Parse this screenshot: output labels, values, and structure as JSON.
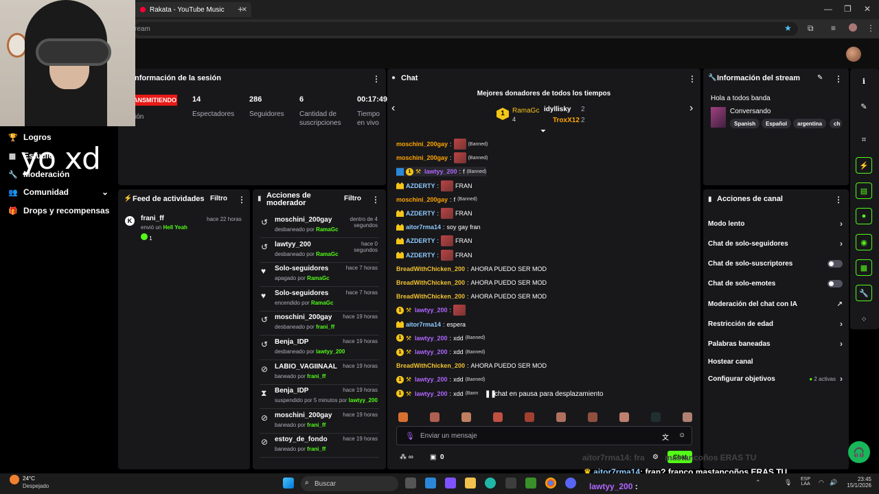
{
  "browser": {
    "tab_title": "Rakata - YouTube Music",
    "new_tab": "+",
    "address": "ream"
  },
  "overlay": {
    "webcam_text": "yo xd"
  },
  "nav": [
    {
      "label": "Logros",
      "icon": "trophy-icon"
    },
    {
      "label": "Estudio",
      "icon": "studio-icon"
    },
    {
      "label": "Moderación",
      "icon": "wrench-icon"
    },
    {
      "label": "Comunidad",
      "icon": "users-icon"
    },
    {
      "label": "Drops y recompensas",
      "icon": "gift-icon"
    }
  ],
  "session": {
    "title": "nformación de la sesión",
    "live": "ANSMITIENDO",
    "live_sub": "ión",
    "stats": [
      {
        "value": "14",
        "label": "Espectadores"
      },
      {
        "value": "286",
        "label": "Seguidores"
      },
      {
        "value": "6",
        "label": "Cantidad de suscripciones"
      },
      {
        "value": "00:17:49",
        "label": "Tiempo en vivo"
      }
    ]
  },
  "feed": {
    "title": "Feed de actividades",
    "filter": "Filtro",
    "item": {
      "user": "frani_ff",
      "action": "envió un",
      "gift": "Hell Yeah",
      "time": "hace 22 horas",
      "count": "1"
    }
  },
  "mod": {
    "title": "Acciones de moderador",
    "filter": "Filtro",
    "rows": [
      {
        "icon": "undo-icon",
        "title": "moschini_200gay",
        "sub": "desbaneado por",
        "by": "RamaGc",
        "time": "dentro de 4 segundos"
      },
      {
        "icon": "undo-icon",
        "title": "lawtyy_200",
        "sub": "desbaneado por",
        "by": "RamaGc",
        "time": "hace 0 segundos"
      },
      {
        "icon": "heart-icon",
        "title": "Solo-seguidores",
        "sub": "apagado por",
        "by": "RamaGc",
        "time": "hace 7 horas"
      },
      {
        "icon": "heart-icon",
        "title": "Solo-seguidores",
        "sub": "encendido por",
        "by": "RamaGc",
        "time": "hace 7 horas"
      },
      {
        "icon": "undo-icon",
        "title": "moschini_200gay",
        "sub": "desbaneado por",
        "by": "frani_ff",
        "time": "hace 19 horas"
      },
      {
        "icon": "undo-icon",
        "title": "Benja_IDP",
        "sub": "desbaneado por",
        "by": "lawtyy_200",
        "time": "hace 19 horas"
      },
      {
        "icon": "ban-icon",
        "title": "LABIO_VAGIINAAL",
        "sub": "baneado por",
        "by": "frani_ff",
        "time": "hace 19 horas"
      },
      {
        "icon": "hourglass-icon",
        "title": "Benja_IDP",
        "sub": "suspendido por 5 minutos por",
        "by": "lawtyy_200",
        "time": "hace 19 horas"
      },
      {
        "icon": "ban-icon",
        "title": "moschini_200gay",
        "sub": "baneado por",
        "by": "frani_ff",
        "time": "hace 19 horas"
      },
      {
        "icon": "ban-icon",
        "title": "estoy_de_fondo",
        "sub": "baneado por",
        "by": "frani_ff",
        "time": "hace 19 horas"
      }
    ]
  },
  "chat": {
    "title": "Chat",
    "donors_title": "Mejores donadores de todos los tiempos",
    "donors": [
      {
        "rank": "1",
        "name": "RamaGc",
        "count": "4"
      },
      {
        "name": "idyllisky",
        "count": "2"
      },
      {
        "name": "TroxX12",
        "count": "2"
      }
    ],
    "messages": [
      {
        "user": "moschini_200gay",
        "color": "or",
        "text": "",
        "emote": true,
        "banned": "(Banned)"
      },
      {
        "user": "moschini_200gay",
        "color": "or",
        "text": "",
        "emote": true,
        "banned": "(Banned)"
      },
      {
        "user": "lawtyy_200",
        "color": "pu",
        "text": "f",
        "banned": "(Banned)",
        "badges": "vc"
      },
      {
        "user": "AZDERTY",
        "color": "cy",
        "text": "FRAN",
        "emote": true,
        "badges": "s"
      },
      {
        "user": "moschini_200gay",
        "color": "or",
        "text": "f",
        "banned": "(Banned)"
      },
      {
        "user": "AZDERTY",
        "color": "cy",
        "text": "FRAN",
        "emote": true,
        "badges": "s"
      },
      {
        "user": "aitor7rma14",
        "color": "cy",
        "text": "soy gay  fran",
        "badges": "s"
      },
      {
        "user": "AZDERTY",
        "color": "cy",
        "text": "FRAN",
        "emote": true,
        "badges": "s"
      },
      {
        "user": "AZDERTY",
        "color": "cy",
        "text": "FRAN",
        "emote": true,
        "badges": "s"
      },
      {
        "user": "BreadWithChicken_200",
        "color": "gd",
        "text": "AHORA PUEDO SER MOD"
      },
      {
        "user": "BreadWithChicken_200",
        "color": "gd",
        "text": "AHORA PUEDO SER MOD"
      },
      {
        "user": "BreadWithChicken_200",
        "color": "gd",
        "text": "AHORA PUEDO SER MOD"
      },
      {
        "user": "lawtyy_200",
        "color": "pu",
        "text": "",
        "emote": true,
        "badges": "cp"
      },
      {
        "user": "aitor7rma14",
        "color": "cy",
        "text": "espera",
        "badges": "s"
      },
      {
        "user": "lawtyy_200",
        "color": "pu",
        "text": "xdd",
        "banned": "(Banned)",
        "badges": "cp"
      },
      {
        "user": "lawtyy_200",
        "color": "pu",
        "text": "xdd",
        "banned": "(Banned)",
        "badges": "cp"
      },
      {
        "user": "BreadWithChicken_200",
        "color": "gd",
        "text": "AHORA PUEDO SER MOD"
      },
      {
        "user": "lawtyy_200",
        "color": "pu",
        "text": "xdd",
        "banned": "(Banned)",
        "badges": "cp"
      },
      {
        "user": "lawtyy_200",
        "color": "pu",
        "text": "xdd",
        "banned": "(Bann",
        "badges": "cp"
      }
    ],
    "paused": "chat en pausa para desplazamiento",
    "placeholder": "Enviar un mensaje",
    "viewers": "0",
    "send": "Chat"
  },
  "stream_info": {
    "title": "Información del stream",
    "stream_title": "Hola a todos banda",
    "category": "Conversando",
    "tags": [
      "Spanish",
      "Español",
      "argentina",
      "ch"
    ]
  },
  "channel": {
    "title": "Acciones de canal",
    "rows": [
      {
        "label": "Modo lento",
        "kind": "chev"
      },
      {
        "label": "Chat de solo-seguidores",
        "kind": "chev"
      },
      {
        "label": "Chat de solo-suscriptores",
        "kind": "toggle"
      },
      {
        "label": "Chat de solo-emotes",
        "kind": "toggle"
      },
      {
        "label": "Moderación del chat con IA",
        "kind": "ext"
      },
      {
        "label": "Restricción de edad",
        "kind": "chev"
      },
      {
        "label": "Palabras baneadas",
        "kind": "chev"
      },
      {
        "label": "Hostear canal",
        "kind": "none"
      },
      {
        "label": "Configurar objetivos",
        "kind": "chev",
        "extra": "2 activas"
      }
    ]
  },
  "overlay_chat": [
    {
      "user": "aitor7rma14",
      "text": ": fra",
      "tail": "mastancoños ERAS TU"
    },
    {
      "user": "aitor7rma14",
      "text": ": fran? franco mastancoños ERAS TU"
    },
    {
      "user": "lawtyy_200",
      "text": ":"
    }
  ],
  "taskbar": {
    "weather_temp": "24°C",
    "weather_desc": "Despejado",
    "search": "Buscar",
    "lang": "ESP",
    "lang2": "LAA",
    "time": "23:45",
    "date": "15/1/2026"
  },
  "colors": {
    "accent": "#53fc18",
    "live": "#e91916",
    "panel": "#18181b"
  }
}
